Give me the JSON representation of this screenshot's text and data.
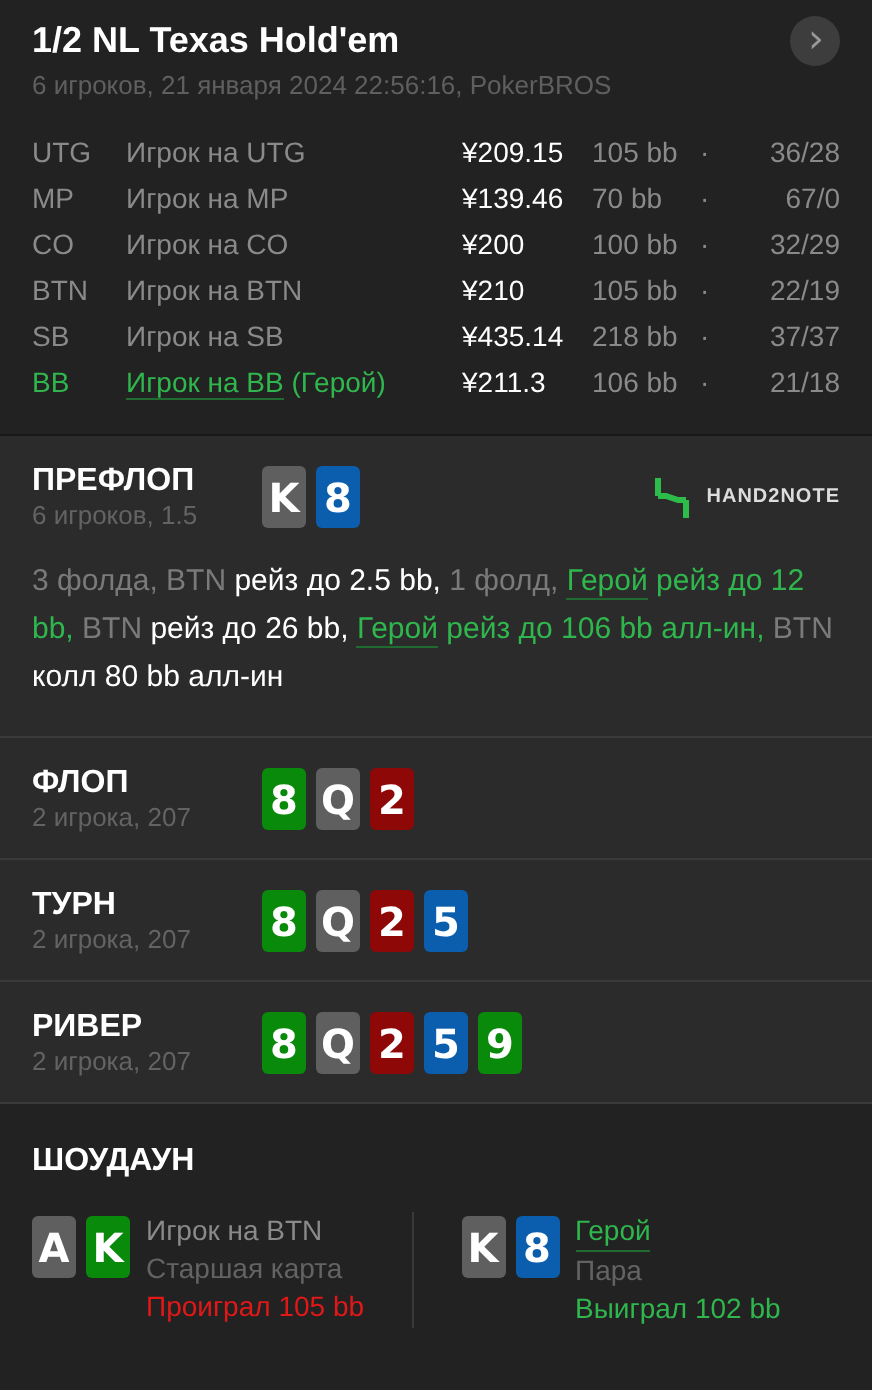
{
  "header": {
    "title": "1/2 NL Texas Hold'em",
    "subtitle": "6 игроков, 21 января 2024 22:56:16, PokerBROS",
    "next_button": "›"
  },
  "players": [
    {
      "position": "UTG",
      "name": "Игрок на UTG",
      "hero": false,
      "stack": "¥209.15",
      "bb": "105 bb",
      "separator": "·",
      "stats": "36/28"
    },
    {
      "position": "MP",
      "name": "Игрок на MP",
      "hero": false,
      "stack": "¥139.46",
      "bb": "70 bb",
      "separator": "·",
      "stats": "67/0"
    },
    {
      "position": "CO",
      "name": "Игрок на CO",
      "hero": false,
      "stack": "¥200",
      "bb": "100 bb",
      "separator": "·",
      "stats": "32/29"
    },
    {
      "position": "BTN",
      "name": "Игрок на BTN",
      "hero": false,
      "stack": "¥210",
      "bb": "105 bb",
      "separator": "·",
      "stats": "22/19"
    },
    {
      "position": "SB",
      "name": "Игрок на SB",
      "hero": false,
      "stack": "¥435.14",
      "bb": "218 bb",
      "separator": "·",
      "stats": "37/37"
    },
    {
      "position": "BB",
      "name": "Игрок на BB",
      "hero": true,
      "hero_label": "(Герой)",
      "stack": "¥211.3",
      "bb": "106 bb",
      "separator": "·",
      "stats": "21/18"
    }
  ],
  "streets": [
    {
      "title": "ПРЕФЛОП",
      "info": "6 игроков, 1.5",
      "cards": [
        {
          "rank": "K",
          "color": "#5f5f5f"
        },
        {
          "rank": "8",
          "color": "#0b5ead"
        }
      ],
      "logo": "HAND2NOTE",
      "actions": [
        {
          "kind": "muted",
          "text": "3 фолда, BTN"
        },
        {
          "kind": "plain",
          "text": " рейз до 2.5 bb,"
        },
        {
          "kind": "muted",
          "text": " 1 фолд, "
        },
        {
          "kind": "hero",
          "text": "Герой"
        },
        {
          "kind": "green",
          "text": " рейз до 12 bb,"
        },
        {
          "kind": "muted",
          "text": " BTN"
        },
        {
          "kind": "plain",
          "text": " рейз до 26 bb, "
        },
        {
          "kind": "hero",
          "text": "Герой"
        },
        {
          "kind": "green",
          "text": " рейз до 106 bb алл-ин,"
        },
        {
          "kind": "muted",
          "text": " BTN"
        },
        {
          "kind": "plain",
          "text": " колл 80 bb алл-ин"
        }
      ]
    },
    {
      "title": "ФЛОП",
      "info": "2 игрока, 207",
      "cards": [
        {
          "rank": "8",
          "color": "#0a8a0a"
        },
        {
          "rank": "Q",
          "color": "#5f5f5f"
        },
        {
          "rank": "2",
          "color": "#8e0808"
        }
      ]
    },
    {
      "title": "ТУРН",
      "info": "2 игрока, 207",
      "cards": [
        {
          "rank": "8",
          "color": "#0a8a0a"
        },
        {
          "rank": "Q",
          "color": "#5f5f5f"
        },
        {
          "rank": "2",
          "color": "#8e0808"
        },
        {
          "rank": "5",
          "color": "#0b5ead"
        }
      ]
    },
    {
      "title": "РИВЕР",
      "info": "2 игрока, 207",
      "cards": [
        {
          "rank": "8",
          "color": "#0a8a0a"
        },
        {
          "rank": "Q",
          "color": "#5f5f5f"
        },
        {
          "rank": "2",
          "color": "#8e0808"
        },
        {
          "rank": "5",
          "color": "#0b5ead"
        },
        {
          "rank": "9",
          "color": "#0a8a0a"
        }
      ]
    }
  ],
  "showdown": {
    "title": "ШОУДАУН",
    "hands": [
      {
        "cards": [
          {
            "rank": "A",
            "color": "#5f5f5f"
          },
          {
            "rank": "K",
            "color": "#0a8a0a"
          }
        ],
        "player": "Игрок на BTN",
        "hero": false,
        "combo": "Старшая карта",
        "result": "Проиграл 105 bb",
        "won": false
      },
      {
        "cards": [
          {
            "rank": "K",
            "color": "#5f5f5f"
          },
          {
            "rank": "8",
            "color": "#0b5ead"
          }
        ],
        "player": "Герой",
        "hero": true,
        "combo": "Пара",
        "result": "Выиграл 102 bb",
        "won": true
      }
    ]
  }
}
